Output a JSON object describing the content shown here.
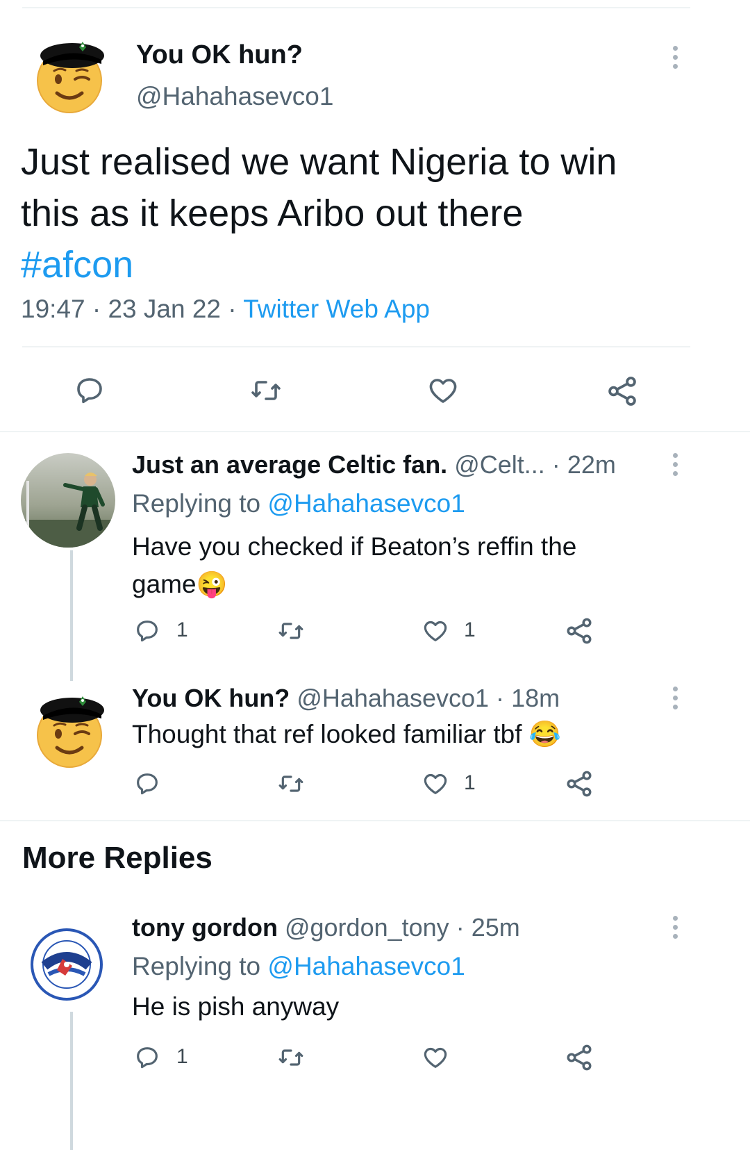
{
  "main_tweet": {
    "display_name": "You OK hun?",
    "handle": "@Hahahasevco1",
    "text_line1": "Just realised we want Nigeria to win",
    "text_line2": "this as it keeps Aribo out there",
    "hashtag": "#afcon",
    "time": "19:47",
    "date": "23 Jan 22",
    "source": "Twitter Web App",
    "sep": "·"
  },
  "replies": [
    {
      "display_name": "Just an average Celtic fan.",
      "handle": "@Celt...",
      "age": "22m",
      "replying_prefix": "Replying to",
      "replying_to": "@Hahahasevco1",
      "text_line1": "Have you checked if Beaton’s reffin the",
      "text_line2": "game",
      "emoji": "😜",
      "reply_count": "1",
      "retweet_count": "",
      "like_count": "1"
    },
    {
      "display_name": "You OK hun?",
      "handle": "@Hahahasevco1",
      "age": "18m",
      "text_line1": "Thought that ref looked familiar tbf",
      "emoji": "😂",
      "reply_count": "",
      "retweet_count": "",
      "like_count": "1"
    }
  ],
  "section_title": "More Replies",
  "more_replies": [
    {
      "display_name": "tony gordon",
      "handle": "@gordon_tony",
      "age": "25m",
      "replying_prefix": "Replying to",
      "replying_to": "@Hahahasevco1",
      "text": "He is pish anyway",
      "reply_count": "1",
      "retweet_count": "",
      "like_count": ""
    }
  ],
  "colors": {
    "link_blue": "#1d9bf0",
    "secondary_text": "#536471",
    "divider": "#eff3f4",
    "icon_grey": "#536471"
  }
}
